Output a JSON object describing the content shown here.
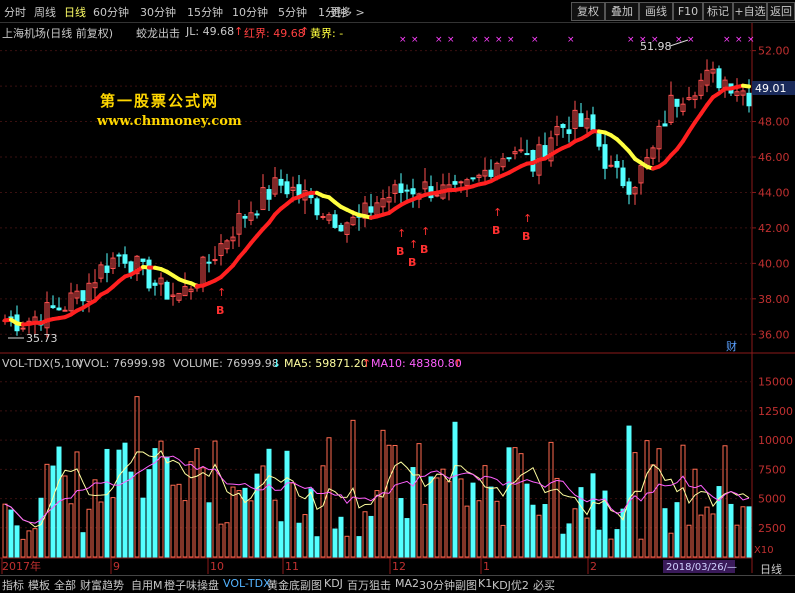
{
  "toolbar": {
    "periods": [
      "分时",
      "周线",
      "日线",
      "60分钟",
      "30分钟",
      "15分钟",
      "10分钟",
      "5分钟",
      "1分钟",
      "更多 >"
    ],
    "active_period": "日线",
    "buttons": [
      "复权",
      "叠加",
      "画线",
      "F10",
      "标记",
      "+自选",
      "返回"
    ]
  },
  "price_panel": {
    "title": "上海机场(日线 前复权)",
    "indicator": "蛟龙出击",
    "jl": "JL: 49.68",
    "red_label": "红界: 49.68",
    "yellow_label": "黄界: -",
    "watermark_cn": "第一股票公式网",
    "watermark_url": "www.chnmoney.com",
    "current_price": "49.01",
    "high_label": "51.98",
    "low_label": "35.73",
    "fin_tag": "财",
    "y_ticks": [
      "52.00",
      "50.00",
      "48.00",
      "46.00",
      "44.00",
      "42.00",
      "40.00",
      "38.00",
      "36.00"
    ],
    "signal_label": "B"
  },
  "vol_panel": {
    "name": "VOL-TDX(5,10)",
    "vvol": "VVOL: 76999.98",
    "volume": "VOLUME: 76999.98",
    "ma5": "MA5: 59871.20",
    "ma10": "MA10: 48380.80",
    "y_ticks": [
      "15000",
      "12500",
      "10000",
      "7500",
      "5000",
      "2500"
    ],
    "unit": "X10"
  },
  "x_axis": {
    "labels": [
      "2017年",
      "9",
      "10",
      "11",
      "12",
      "1",
      "2"
    ],
    "cursor_date": "2018/03/26/—"
  },
  "right_tab": "日线",
  "bottom_tabs": [
    "指标",
    "模板",
    "全部",
    "财富趋势",
    "自用M",
    "橙子味操盘",
    "VOL-TDX",
    "黄金底副图",
    "KDJ",
    "百万狙击",
    "MA2",
    "30分钟副图",
    "K1",
    "KDJ优2",
    "必买"
  ],
  "active_bottom_tab": "VOL-TDX",
  "colors": {
    "up": "#ff5050",
    "down": "#54ffff",
    "line_red": "#ff2020",
    "line_yellow": "#ffff40",
    "magenta": "#ff40ff",
    "ma5": "#ffffa0",
    "ma10": "#ff60ff"
  }
}
